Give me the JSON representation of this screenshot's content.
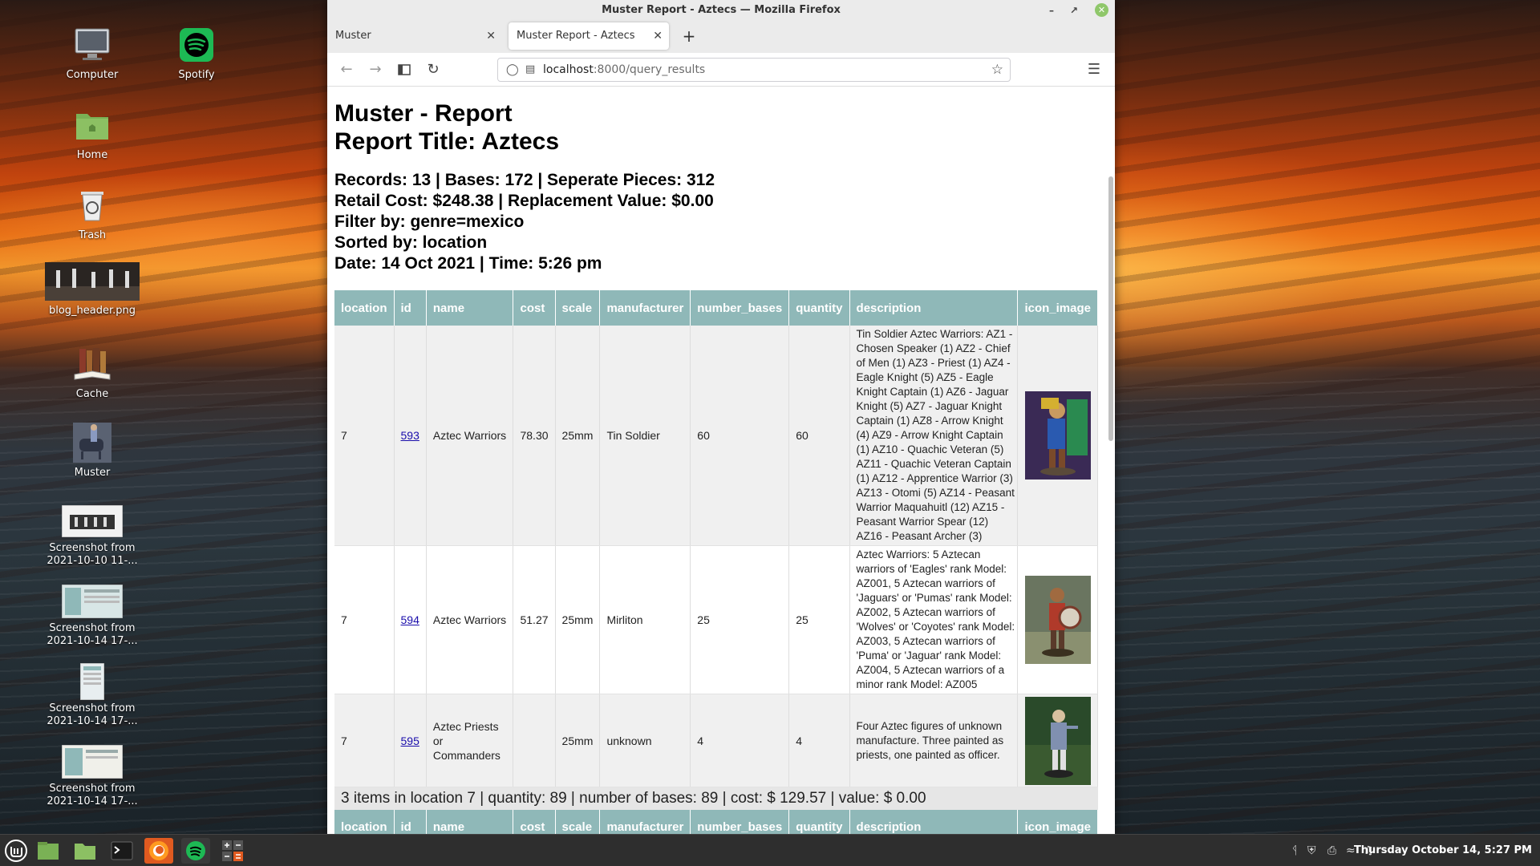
{
  "window": {
    "title": "Muster Report - Aztecs — Mozilla Firefox"
  },
  "tabs": [
    {
      "label": "Muster"
    },
    {
      "label": "Muster Report - Aztecs"
    }
  ],
  "navbar": {
    "url_host": "localhost",
    "url_path": ":8000/query_results"
  },
  "desktop": {
    "icons": [
      {
        "label": "Computer"
      },
      {
        "label": "Spotify"
      },
      {
        "label": "Home"
      },
      {
        "label": "Trash"
      },
      {
        "label": "blog_header.png"
      },
      {
        "label": "Cache"
      },
      {
        "label": "Muster"
      },
      {
        "label": "Screenshot from 2021-10-10 11-..."
      },
      {
        "label": "Screenshot from 2021-10-14 17-..."
      },
      {
        "label": "Screenshot from 2021-10-14 17-..."
      },
      {
        "label": "Screenshot from 2021-10-14 17-..."
      }
    ]
  },
  "report": {
    "heading": "Muster - Report",
    "title": "Report Title: Aztecs",
    "stats": [
      "Records: 13 | Bases: 172 | Seperate Pieces: 312",
      "Retail Cost: $248.38 | Replacement Value: $0.00",
      "Filter by: genre=mexico",
      "Sorted by: location",
      "Date: 14 Oct 2021 | Time: 5:26 pm"
    ],
    "columns": [
      "location",
      "id",
      "name",
      "cost",
      "scale",
      "manufacturer",
      "number_bases",
      "quantity",
      "description",
      "icon_image"
    ],
    "rows": [
      {
        "location": "7",
        "id": "593",
        "name": "Aztec Warriors",
        "cost": "78.30",
        "scale": "25mm",
        "manufacturer": "Tin Soldier",
        "number_bases": "60",
        "quantity": "60",
        "description": "Tin Soldier Aztec Warriors: AZ1 - Chosen Speaker (1) AZ2 - Chief of Men (1) AZ3 - Priest (1) AZ4 - Eagle Knight (5) AZ5 - Eagle Knight Captain (1) AZ6 - Jaguar Knight (5) AZ7 - Jaguar Knight Captain (1) AZ8 - Arrow Knight (4) AZ9 - Arrow Knight Captain (1) AZ10 - Quachic Veteran (5) AZ11 - Quachic Veteran Captain (1) AZ12 - Apprentice Warrior (3) AZ13 - Otomi (5) AZ14 - Peasant Warrior Maquahuitl (12) AZ15 - Peasant Warrior Spear (12) AZ16 - Peasant Archer (3)"
      },
      {
        "location": "7",
        "id": "594",
        "name": "Aztec Warriors",
        "cost": "51.27",
        "scale": "25mm",
        "manufacturer": "Mirliton",
        "number_bases": "25",
        "quantity": "25",
        "description": "Aztec Warriors: 5 Aztecan warriors of 'Eagles' rank Model: AZ001, 5 Aztecan warriors of 'Jaguars' or 'Pumas' rank Model: AZ002, 5 Aztecan warriors of 'Wolves' or 'Coyotes' rank Model: AZ003, 5 Aztecan warriors of 'Puma' or 'Jaguar' rank Model: AZ004, 5 Aztecan warriors of a minor rank Model: AZ005"
      },
      {
        "location": "7",
        "id": "595",
        "name": "Aztec Priests or Commanders",
        "cost": "",
        "scale": "25mm",
        "manufacturer": "unknown",
        "number_bases": "4",
        "quantity": "4",
        "description": "Four Aztec figures of unknown manufacture. Three painted as priests, one painted as officer."
      }
    ],
    "summary": "3 items in location 7 | quantity: 89 | number of bases: 89 | cost: $ 129.57 | value: $ 0.00"
  },
  "taskbar": {
    "clock": "Thursday October 14, 5:27 PM"
  }
}
